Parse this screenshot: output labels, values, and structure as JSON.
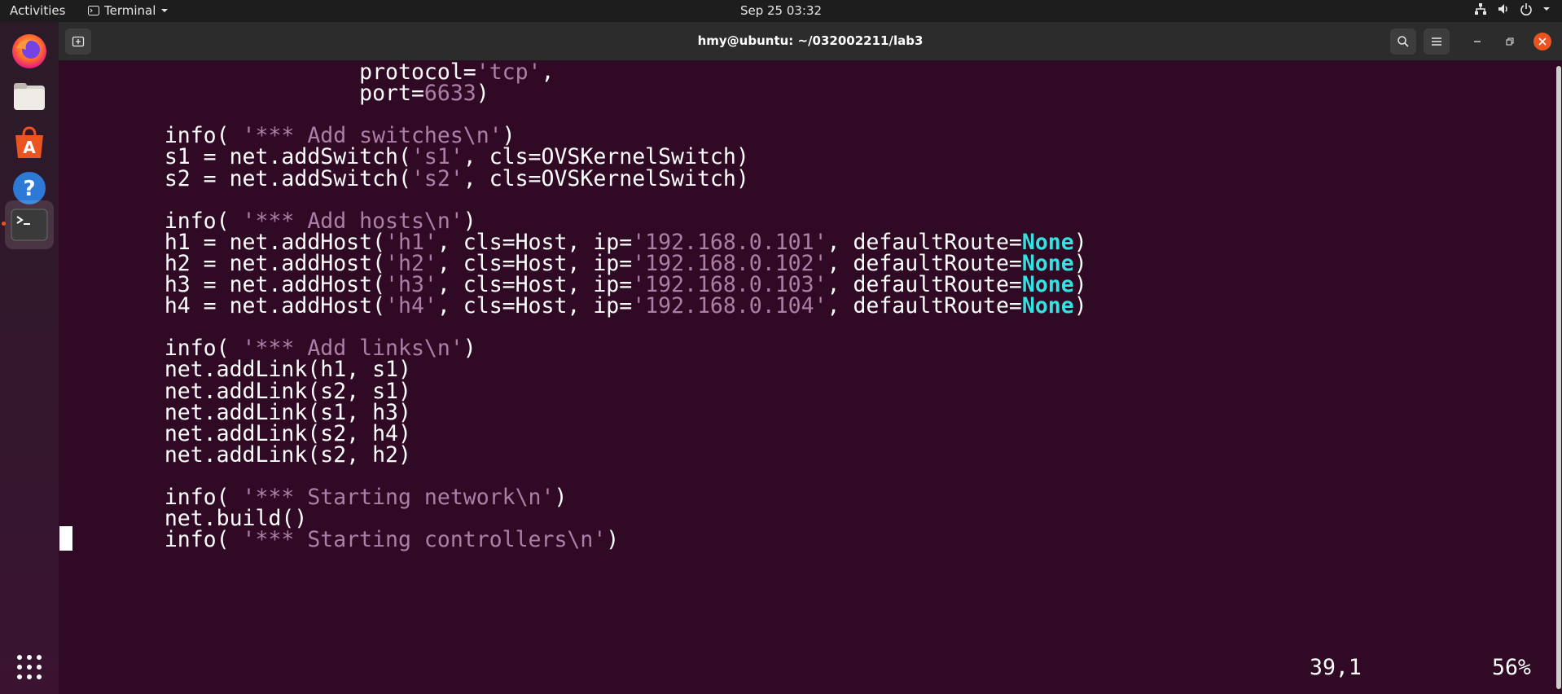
{
  "topbar": {
    "activities": "Activities",
    "app_name": "Terminal",
    "clock": "Sep 25  03:32"
  },
  "dock": {
    "items": [
      "firefox-icon",
      "files-icon",
      "app-store-icon",
      "help-icon",
      "terminal-icon",
      "show-apps-icon"
    ],
    "accent": "#e95420"
  },
  "window": {
    "title": "hmy@ubuntu: ~/032002211/lab3"
  },
  "terminal": {
    "lines": [
      [
        {
          "t": "                   protocol="
        },
        {
          "t": "'tcp'",
          "c": "s"
        },
        {
          "t": ","
        }
      ],
      [
        {
          "t": "                   port="
        },
        {
          "t": "6633",
          "c": "n"
        },
        {
          "t": ")"
        }
      ],
      [
        {
          "t": ""
        }
      ],
      [
        {
          "t": "    info( "
        },
        {
          "t": "'*** Add switches\\n'",
          "c": "s"
        },
        {
          "t": ")"
        }
      ],
      [
        {
          "t": "    s1 = net.addSwitch("
        },
        {
          "t": "'s1'",
          "c": "s"
        },
        {
          "t": ", cls=OVSKernelSwitch)"
        }
      ],
      [
        {
          "t": "    s2 = net.addSwitch("
        },
        {
          "t": "'s2'",
          "c": "s"
        },
        {
          "t": ", cls=OVSKernelSwitch)"
        }
      ],
      [
        {
          "t": ""
        }
      ],
      [
        {
          "t": "    info( "
        },
        {
          "t": "'*** Add hosts\\n'",
          "c": "s"
        },
        {
          "t": ")"
        }
      ],
      [
        {
          "t": "    h1 = net.addHost("
        },
        {
          "t": "'h1'",
          "c": "s"
        },
        {
          "t": ", cls=Host, ip="
        },
        {
          "t": "'192.168.0.101'",
          "c": "s"
        },
        {
          "t": ", defaultRoute="
        },
        {
          "t": "None",
          "c": "kw"
        },
        {
          "t": ")"
        }
      ],
      [
        {
          "t": "    h2 = net.addHost("
        },
        {
          "t": "'h2'",
          "c": "s"
        },
        {
          "t": ", cls=Host, ip="
        },
        {
          "t": "'192.168.0.102'",
          "c": "s"
        },
        {
          "t": ", defaultRoute="
        },
        {
          "t": "None",
          "c": "kw"
        },
        {
          "t": ")"
        }
      ],
      [
        {
          "t": "    h3 = net.addHost("
        },
        {
          "t": "'h3'",
          "c": "s"
        },
        {
          "t": ", cls=Host, ip="
        },
        {
          "t": "'192.168.0.103'",
          "c": "s"
        },
        {
          "t": ", defaultRoute="
        },
        {
          "t": "None",
          "c": "kw"
        },
        {
          "t": ")"
        }
      ],
      [
        {
          "t": "    h4 = net.addHost("
        },
        {
          "t": "'h4'",
          "c": "s"
        },
        {
          "t": ", cls=Host, ip="
        },
        {
          "t": "'192.168.0.104'",
          "c": "s"
        },
        {
          "t": ", defaultRoute="
        },
        {
          "t": "None",
          "c": "kw"
        },
        {
          "t": ")"
        }
      ],
      [
        {
          "t": ""
        }
      ],
      [
        {
          "t": "    info( "
        },
        {
          "t": "'*** Add links\\n'",
          "c": "s"
        },
        {
          "t": ")"
        }
      ],
      [
        {
          "t": "    net.addLink(h1, s1)"
        }
      ],
      [
        {
          "t": "    net.addLink(s2, s1)"
        }
      ],
      [
        {
          "t": "    net.addLink(s1, h3)"
        }
      ],
      [
        {
          "t": "    net.addLink(s2, h4)"
        }
      ],
      [
        {
          "t": "    net.addLink(s2, h2)"
        }
      ],
      [
        {
          "t": ""
        }
      ],
      [
        {
          "t": "    info( "
        },
        {
          "t": "'*** Starting network\\n'",
          "c": "s"
        },
        {
          "t": ")"
        }
      ],
      [
        {
          "t": "    net.build()"
        }
      ],
      [
        {
          "t": "    info( "
        },
        {
          "t": "'*** Starting controllers\\n'",
          "c": "s"
        },
        {
          "t": ")"
        }
      ]
    ],
    "status_position": "39,1",
    "status_percent": "56%",
    "colors": {
      "string": "#ad7fa8",
      "keyword": "#34e2e2",
      "background": "#300a24"
    }
  }
}
